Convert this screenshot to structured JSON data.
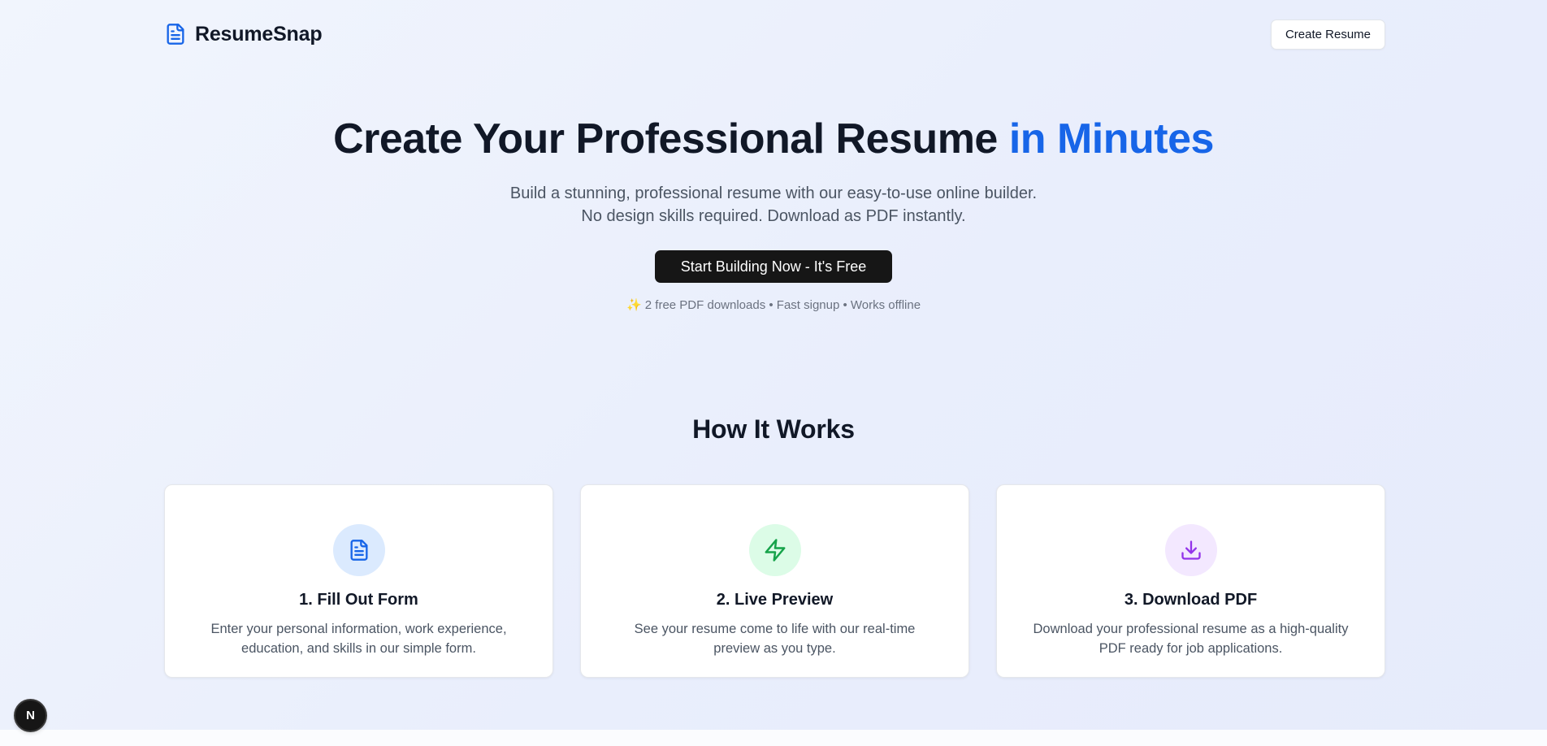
{
  "header": {
    "brand": "ResumeSnap",
    "create_label": "Create Resume"
  },
  "hero": {
    "title_main": "Create Your Professional Resume",
    "title_accent": "in Minutes",
    "subtitle": "Build a stunning, professional resume with our easy-to-use online builder. No design skills required. Download as PDF instantly.",
    "cta_label": "Start Building Now - It's Free",
    "perks": "✨ 2 free PDF downloads • Fast signup • Works offline"
  },
  "how": {
    "title": "How It Works",
    "steps": [
      {
        "title": "1. Fill Out Form",
        "desc": "Enter your personal information, work experience, education, and skills in our simple form.",
        "icon": "document-icon",
        "color": "#1765e8",
        "bg": "#dbeafe"
      },
      {
        "title": "2. Live Preview",
        "desc": "See your resume come to life with our real-time preview as you type.",
        "icon": "lightning-icon",
        "color": "#16a34a",
        "bg": "#dcfce7"
      },
      {
        "title": "3. Download PDF",
        "desc": "Download your professional resume as a high-quality PDF ready for job applications.",
        "icon": "download-icon",
        "color": "#9333ea",
        "bg": "#f3e8ff"
      }
    ]
  },
  "dev_badge": {
    "label": "N"
  },
  "colors": {
    "accent": "#1765e8",
    "cta": "#161616"
  }
}
